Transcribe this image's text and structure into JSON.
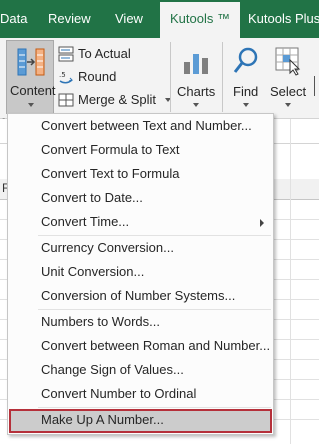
{
  "tabs": [
    {
      "label": "Data"
    },
    {
      "label": "Review"
    },
    {
      "label": "View"
    },
    {
      "label": "Kutools ™"
    },
    {
      "label": "Kutools Plus"
    }
  ],
  "ribbon": {
    "content_label": "Content",
    "to_actual_label": "To Actual",
    "round_label": "Round",
    "merge_split_label": "Merge & Split",
    "charts_label": "Charts",
    "find_label": "Find",
    "select_label": "Select",
    "partial_label": "&",
    "sheet_partial_label": "F"
  },
  "menu": {
    "groups": [
      [
        "Convert between Text and Number...",
        "Convert Formula to Text",
        "Convert Text to Formula",
        "Convert to Date...",
        "Convert Time..."
      ],
      [
        "Currency Conversion...",
        "Unit Conversion...",
        "Conversion of Number Systems..."
      ],
      [
        "Numbers to Words...",
        "Convert between Roman and Number...",
        "Change Sign of Values...",
        "Convert Number to Ordinal"
      ]
    ],
    "highlighted": "Make Up A Number..."
  },
  "colors": {
    "ribbon_green": "#217346",
    "highlight_border": "#b5303a"
  },
  "icons": {
    "content": "content-icon",
    "to_actual": "to-actual-icon",
    "round": "round-icon",
    "merge_split": "merge-split-icon",
    "charts": "charts-icon",
    "find": "find-icon",
    "select": "select-icon"
  }
}
